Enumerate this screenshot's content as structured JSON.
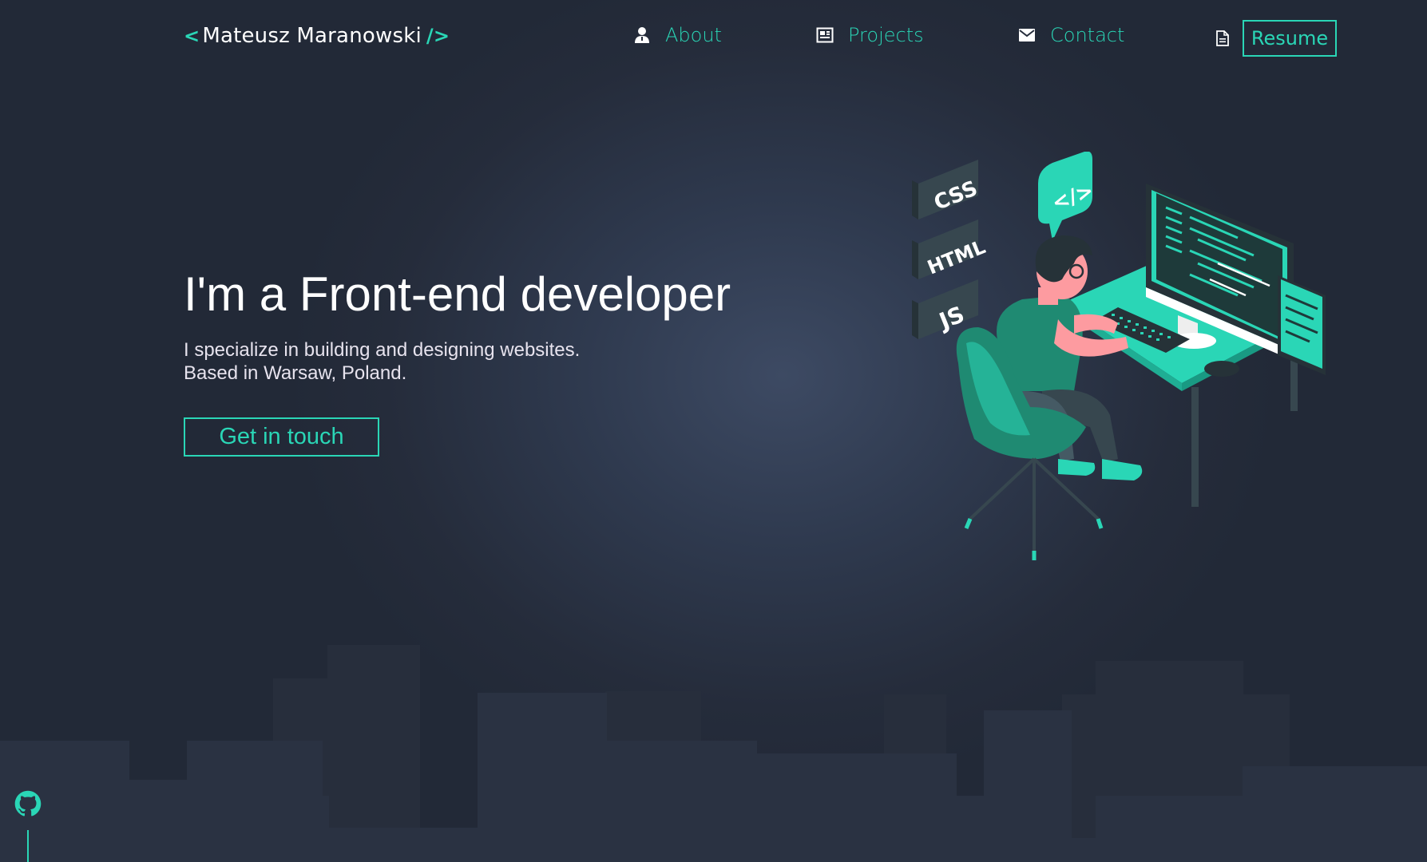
{
  "brand": {
    "open": "<",
    "name": "Mateusz Maranowski",
    "close": "/>"
  },
  "nav": {
    "items": [
      {
        "label": "About",
        "icon": "person-icon"
      },
      {
        "label": "Projects",
        "icon": "newspaper-icon"
      },
      {
        "label": "Contact",
        "icon": "envelope-icon"
      }
    ],
    "resume": {
      "label": "Resume",
      "icon": "document-icon"
    }
  },
  "hero": {
    "title": "I'm a Front-end developer",
    "subtitle_line1": "I specialize in building and designing websites.",
    "subtitle_line2": "Based in Warsaw, Poland.",
    "cta": "Get in touch"
  },
  "illustration": {
    "tags": [
      "CSS",
      "HTML",
      "JS"
    ],
    "code_badge": "</>"
  },
  "footer": {
    "github_icon": "github-icon"
  },
  "colors": {
    "accent": "#2ad6b6",
    "background": "#252c3b",
    "text": "#ffffff"
  }
}
